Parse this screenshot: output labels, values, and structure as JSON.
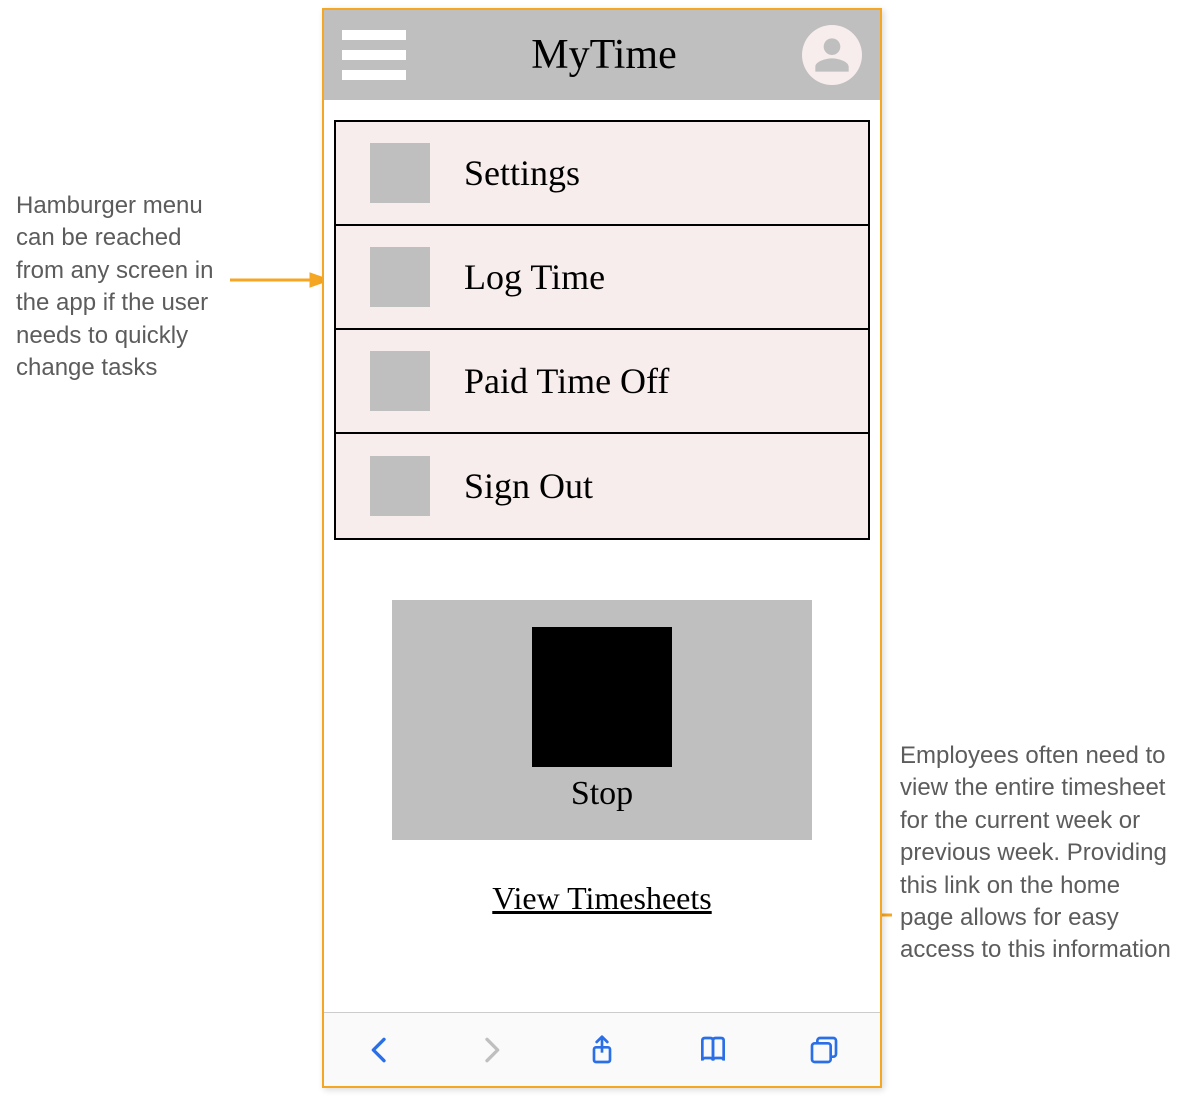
{
  "annotations": {
    "left": "Hamburger menu can be reached from any screen in the app if the user needs to quickly change tasks",
    "right": "Employees often need to view the entire timesheet for the current week or previous week. Providing this link on the home page allows for easy access to this information"
  },
  "header": {
    "title": "MyTime"
  },
  "menu": {
    "items": [
      {
        "label": "Settings"
      },
      {
        "label": "Log Time"
      },
      {
        "label": "Paid Time Off"
      },
      {
        "label": "Sign Out"
      }
    ]
  },
  "main": {
    "stop_label": "Stop",
    "view_link": "View Timesheets"
  },
  "icons": {
    "hamburger": "hamburger-icon",
    "avatar": "person-icon",
    "back": "back-icon",
    "forward": "forward-icon",
    "share": "share-icon",
    "book": "bookmarks-icon",
    "tabs": "tabs-icon"
  },
  "colors": {
    "frame_border": "#f5a623",
    "header_bg": "#bfbfbf",
    "menu_bg": "#f7eded",
    "icon_blue": "#2a6fe8",
    "annotation_text": "#5c5c5c"
  }
}
